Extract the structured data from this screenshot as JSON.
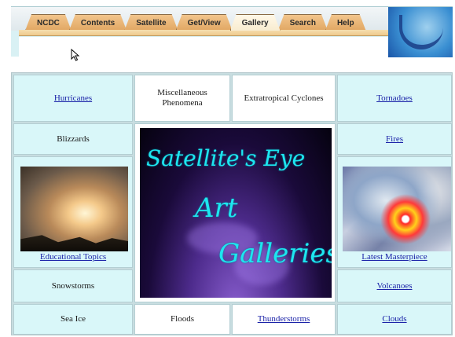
{
  "nav": {
    "tabs": [
      "NCDC",
      "Contents",
      "Satellite",
      "Get/View",
      "Gallery",
      "Search",
      "Help"
    ],
    "active_tab": "Gallery"
  },
  "gallery": {
    "hurricanes": "Hurricanes",
    "misc": "Miscellaneous Phenomena",
    "extratropical": "Extratropical Cyclones",
    "tornadoes": "Tornadoes",
    "blizzards": "Blizzards",
    "fires": "Fires",
    "educational": "Educational Topics",
    "latest": "Latest Masterpiece",
    "snowstorms": "Snowstorms",
    "volcanoes": "Volcanoes",
    "sea_ice": "Sea Ice",
    "floods": "Floods",
    "thunderstorms": "Thunderstorms",
    "clouds": "Clouds"
  },
  "banner": {
    "line1": "Satellite's Eye",
    "line2": "Art",
    "line3": "Galleries",
    "text_color": "#1de6f0"
  },
  "colors": {
    "cell_bg": "#d9f7f9",
    "link": "#1a22a8",
    "tab_orange": "#e1a763"
  }
}
